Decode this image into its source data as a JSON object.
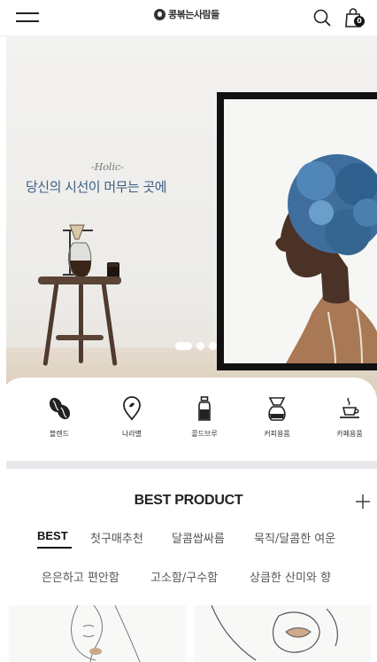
{
  "header": {
    "brand": "콩볶는사람들",
    "cart_count": "0"
  },
  "hero": {
    "script_text": "-Holic-",
    "headline": "당신의 시선이 머무는 곳에",
    "slides": 3,
    "active_slide": 1
  },
  "categories": [
    {
      "label": "블렌드",
      "icon": "coffee-beans-icon"
    },
    {
      "label": "나라별",
      "icon": "location-pin-icon"
    },
    {
      "label": "콜드브루",
      "icon": "cold-brew-bottle-icon"
    },
    {
      "label": "커피용품",
      "icon": "coffee-dripper-icon"
    },
    {
      "label": "카페용품",
      "icon": "hot-cup-icon"
    }
  ],
  "best": {
    "title": "BEST PRODUCT",
    "tabs_row1": [
      "BEST",
      "첫구매추천",
      "달콤쌉싸름",
      "묵직/달콤한 여운"
    ],
    "tabs_row2": [
      "은은하고 편안함",
      "고소함/구수함",
      "상큼한 산미와 향"
    ],
    "active_tab": "BEST"
  },
  "colors": {
    "accent": "#111111",
    "headline": "#3d5f86",
    "divider": "#e7e7ec"
  }
}
